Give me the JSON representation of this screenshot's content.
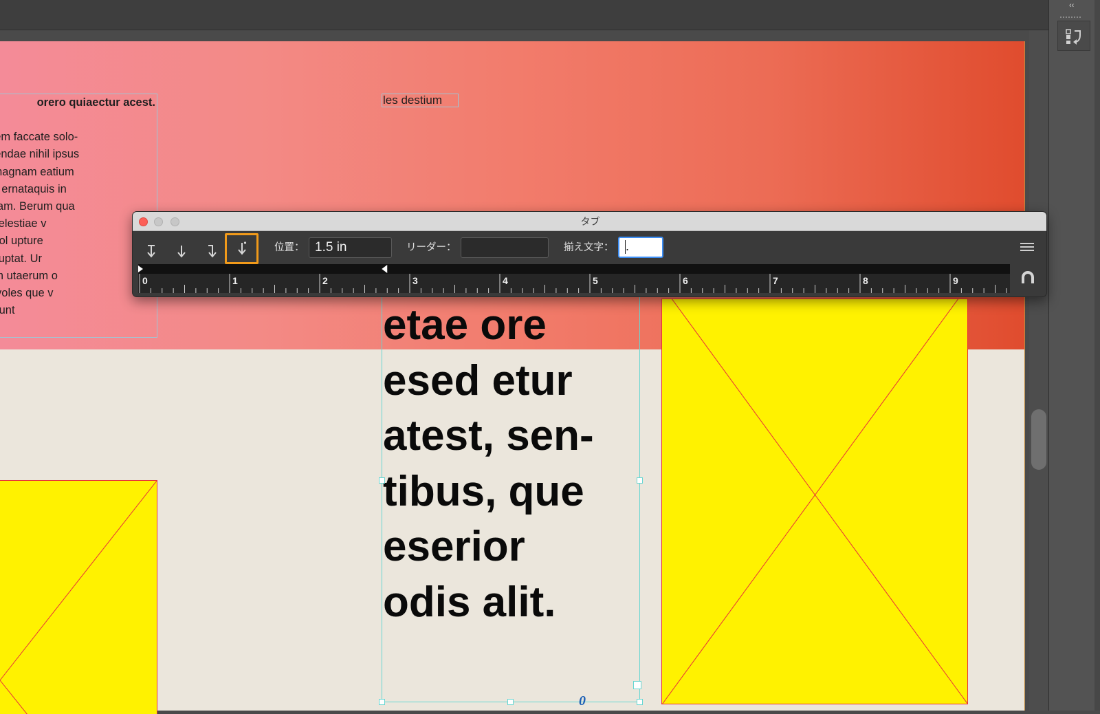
{
  "app": {
    "collapse_label": "‹‹",
    "panel_icon": "tab-panel-icon"
  },
  "document": {
    "body_heading": "orero quiaectur acest.",
    "body_lines": [
      "e volore verem faccate solo-",
      "ius.Pero volendae nihil ipsus",
      "quidel maximagnam eatium",
      "riae asperep ernataquis in",
      "ota tibus, quam. Berum qua",
      "d quo bero velestiae v",
      "ae del essimol upture",
      "um venis soluptat. Ur",
      "n vit molorum utaerum o",
      "uat velibus, voles que v",
      "e et faccati sunt"
    ],
    "small_frame_text": "les destium",
    "big_text_lines": [
      "etae ore",
      "esed etur",
      "atest, sen-",
      "tibus, que",
      "eserior",
      "odis alit."
    ],
    "overflow_mark": "0"
  },
  "tabs_dialog": {
    "title": "タブ",
    "buttons": [
      {
        "name": "left-justified-tab-button",
        "icon": "left-tab-icon"
      },
      {
        "name": "center-justified-tab-button",
        "icon": "center-tab-icon"
      },
      {
        "name": "right-justified-tab-button",
        "icon": "right-tab-icon"
      },
      {
        "name": "align-to-decimal-tab-button",
        "icon": "decimal-tab-icon",
        "selected": true
      }
    ],
    "position_label": "位置：",
    "position_value": "1.5 in",
    "leader_label": "リーダー：",
    "leader_value": "",
    "align_on_label": "揃え文字：",
    "align_on_value": ".",
    "ruler_numbers": [
      "0",
      "1",
      "2",
      "3",
      "4",
      "5",
      "6",
      "7",
      "8",
      "9"
    ],
    "tab_stop_position_in": 2.75
  },
  "colors": {
    "accent_selected": "#f19a1a",
    "placeholder_fill": "#fff200",
    "placeholder_stroke": "#e8303a",
    "frame_stroke": "#66d6d2",
    "focus_ring": "#3d8ef4"
  }
}
